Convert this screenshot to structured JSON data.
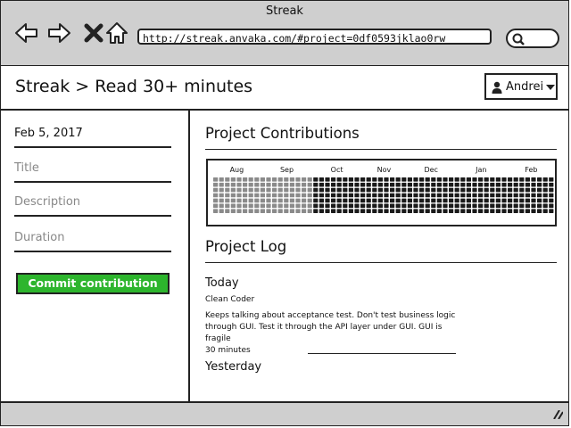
{
  "window": {
    "title": "Streak"
  },
  "toolbar": {
    "url": "http://streak.anvaka.com/#project=0df0593jklao0rw",
    "icons": [
      "back-icon",
      "forward-icon",
      "close-icon",
      "home-icon",
      "search-icon"
    ]
  },
  "header": {
    "breadcrumb": "Streak > Read 30+ minutes",
    "user": {
      "name": "Andrei",
      "icon": "user-icon"
    }
  },
  "form": {
    "date": "Feb 5, 2017",
    "title_placeholder": "Title",
    "description_placeholder": "Description",
    "duration_placeholder": "Duration",
    "commit_label": "Commit contribution",
    "commit_color": "#2db52d"
  },
  "contributions": {
    "title": "Project Contributions",
    "months": [
      "Aug",
      "Sep",
      "Oct",
      "Nov",
      "Dec",
      "Jan",
      "Feb"
    ],
    "colors": {
      "empty": "#8a8a8a",
      "filled": "#1a1a1a"
    }
  },
  "log": {
    "title": "Project Log",
    "entries": [
      {
        "date": "Today",
        "name": "Clean Coder",
        "description": "Keeps talking about acceptance test. Don't test business logic through GUI. Test it through the API layer under GUI. GUI is fragile",
        "duration": "30 minutes"
      },
      {
        "date": "Yesterday"
      }
    ]
  }
}
